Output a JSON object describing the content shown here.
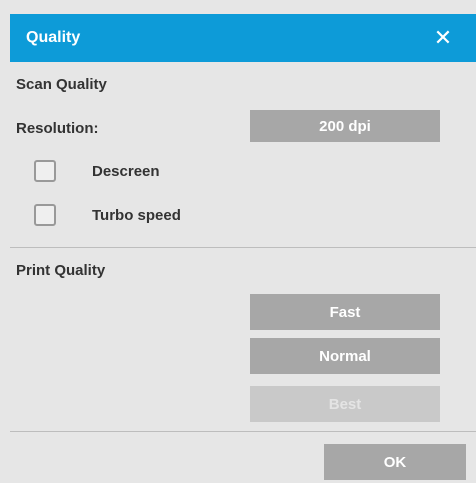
{
  "dialog": {
    "title": "Quality",
    "close_icon": "close-icon",
    "close_glyph": "✕"
  },
  "scan_quality": {
    "heading": "Scan Quality",
    "resolution_label": "Resolution:",
    "resolution_value": "200 dpi",
    "options": [
      {
        "label": "Descreen",
        "checked": false
      },
      {
        "label": "Turbo speed",
        "checked": false
      }
    ]
  },
  "print_quality": {
    "heading": "Print Quality",
    "buttons": [
      {
        "label": "Fast",
        "enabled": true
      },
      {
        "label": "Normal",
        "enabled": true
      },
      {
        "label": "Best",
        "enabled": false
      }
    ]
  },
  "footer": {
    "ok_label": "OK"
  },
  "colors": {
    "titlebar": "#0d9bd8",
    "button": "#a7a7a7",
    "button_disabled": "#c9c9c9",
    "background": "#e6e6e6"
  }
}
